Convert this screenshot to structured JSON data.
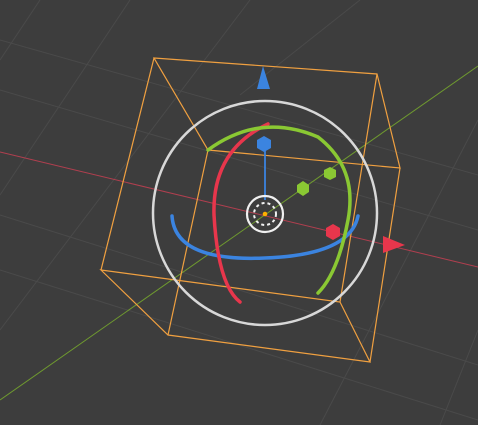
{
  "viewport": {
    "background_color": "#3d3d3d",
    "grid_color": "#4a4a4a"
  },
  "axes": {
    "x_axis_color": "#b13f4f",
    "y_axis_color": "#6f9a2f"
  },
  "selection": {
    "bounding_box_color": "#f0a040"
  },
  "gizmo": {
    "trackball_color": "#d8d8d8",
    "x_color": "#e8364c",
    "y_color": "#8ac833",
    "z_color": "#3b84e0",
    "pivot_color": "#ffb000",
    "center_ring_color": "#f0f0f0"
  }
}
